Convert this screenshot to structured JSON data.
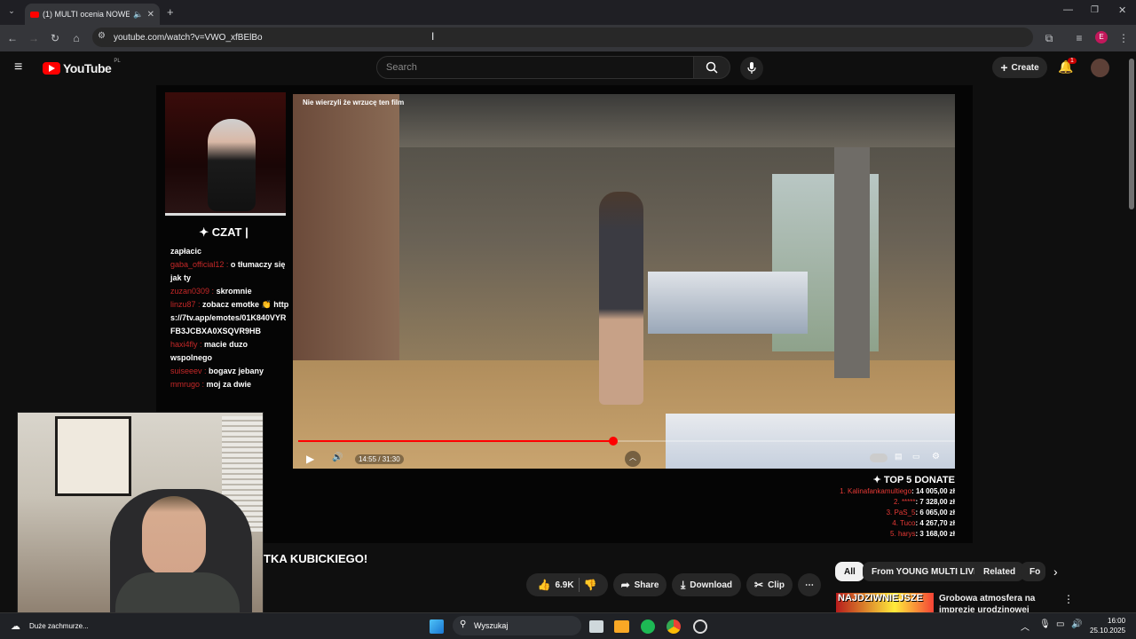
{
  "browser": {
    "tab_title": "(1) MULTI ocenia NOWE M",
    "url": "youtube.com/watch?v=VWO_xfBElBo"
  },
  "youtube": {
    "logo_text": "YouTube",
    "region": "PL",
    "search_placeholder": "Search",
    "create_label": "Create",
    "notification_count": "1"
  },
  "player": {
    "video_overlay_title": "Nie wierzyli że wrzucę ten film",
    "time": "14:55 / 31:30",
    "progress": 0.48
  },
  "stream_overlay": {
    "chat_header": "✦ CZAT |",
    "chat_lines": [
      {
        "user": "",
        "text": "zapłacic"
      },
      {
        "user": "gaba_official12 :",
        "text": "o tłumaczy się jak ty"
      },
      {
        "user": "zuzan0309 :",
        "text": "skromnie"
      },
      {
        "user": "linzu87 :",
        "text": "zobacz emotke 👏 https://7tv.app/emotes/01K840VYRFB3JCBXA0XSQVR9HB"
      },
      {
        "user": "haxi4fly :",
        "text": "macie duzo wspolnego"
      },
      {
        "user": "suiseeev :",
        "text": "bogavz jebany"
      },
      {
        "user": "mmrugo :",
        "text": "moj za dwie"
      }
    ],
    "donate_header": "✦ TOP 5 DONATE",
    "donates": [
      {
        "name": "1. Kalinafankamultiego",
        "amount": ": 14 005,00 zł"
      },
      {
        "name": "2. *****",
        "amount": ": 7 328,00 zł"
      },
      {
        "name": "3. PaS_5",
        "amount": ": 6 065,00 zł"
      },
      {
        "name": "4. Tuco",
        "amount": ": 4 267,70 zł"
      },
      {
        "name": "5. harys",
        "amount": ": 3 168,00 zł"
      }
    ]
  },
  "below_video": {
    "title_fragment": "TKA KUBICKIEGO!",
    "like_count": "6.9K",
    "share_label": "Share",
    "download_label": "Download",
    "clip_label": "Clip"
  },
  "recommendations": {
    "chips": [
      "All",
      "From YOUNG MULTI LIVE",
      "Related",
      "Fo"
    ],
    "first_thumb_text": "NAJDZIWNIEJSZE",
    "first_title": "Grobowa atmosfera na imprezie urodzinowej"
  },
  "taskbar": {
    "weather": "Duże zachmurze...",
    "search_label": "Wyszukaj",
    "time": "16:00",
    "date": "25.10.2025"
  },
  "colors": {
    "accent": "#ff0000",
    "background": "#0f0f0f",
    "chat_username": "#c62828"
  }
}
